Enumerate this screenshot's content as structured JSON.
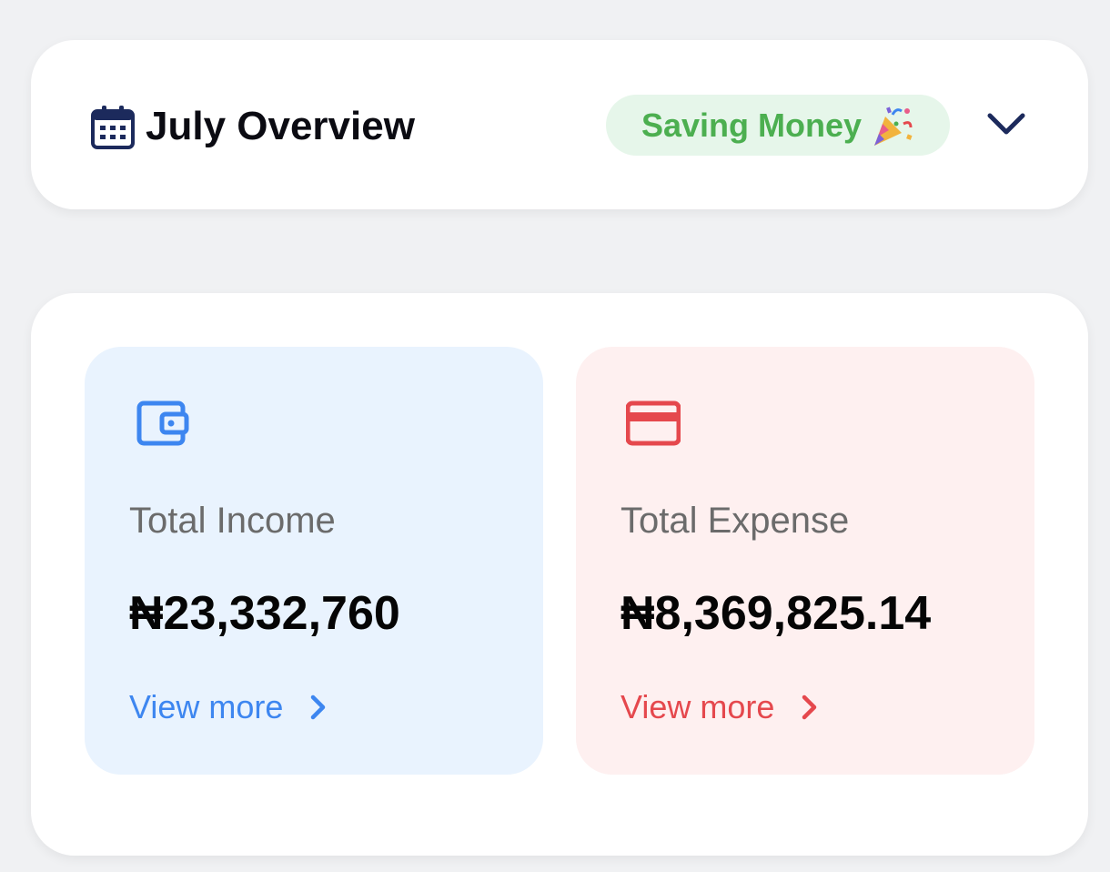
{
  "header": {
    "title": "July Overview",
    "status_badge": "Saving Money",
    "status_icon": "party-popper-icon",
    "toggle_icon": "chevron-down-icon"
  },
  "income": {
    "label": "Total Income",
    "amount": "₦23,332,760",
    "link": "View more",
    "icon": "wallet-icon"
  },
  "expense": {
    "label": "Total Expense",
    "amount": "₦8,369,825.14",
    "link": "View more",
    "icon": "credit-card-icon"
  },
  "colors": {
    "background": "#F0F1F3",
    "navy": "#1C2A5C",
    "income_accent": "#3D86F0",
    "income_tile": "#E9F3FE",
    "expense_accent": "#E5484D",
    "expense_tile": "#FEF0F0",
    "badge_text": "#4CAF50",
    "badge_bg": "#E6F6EA"
  }
}
